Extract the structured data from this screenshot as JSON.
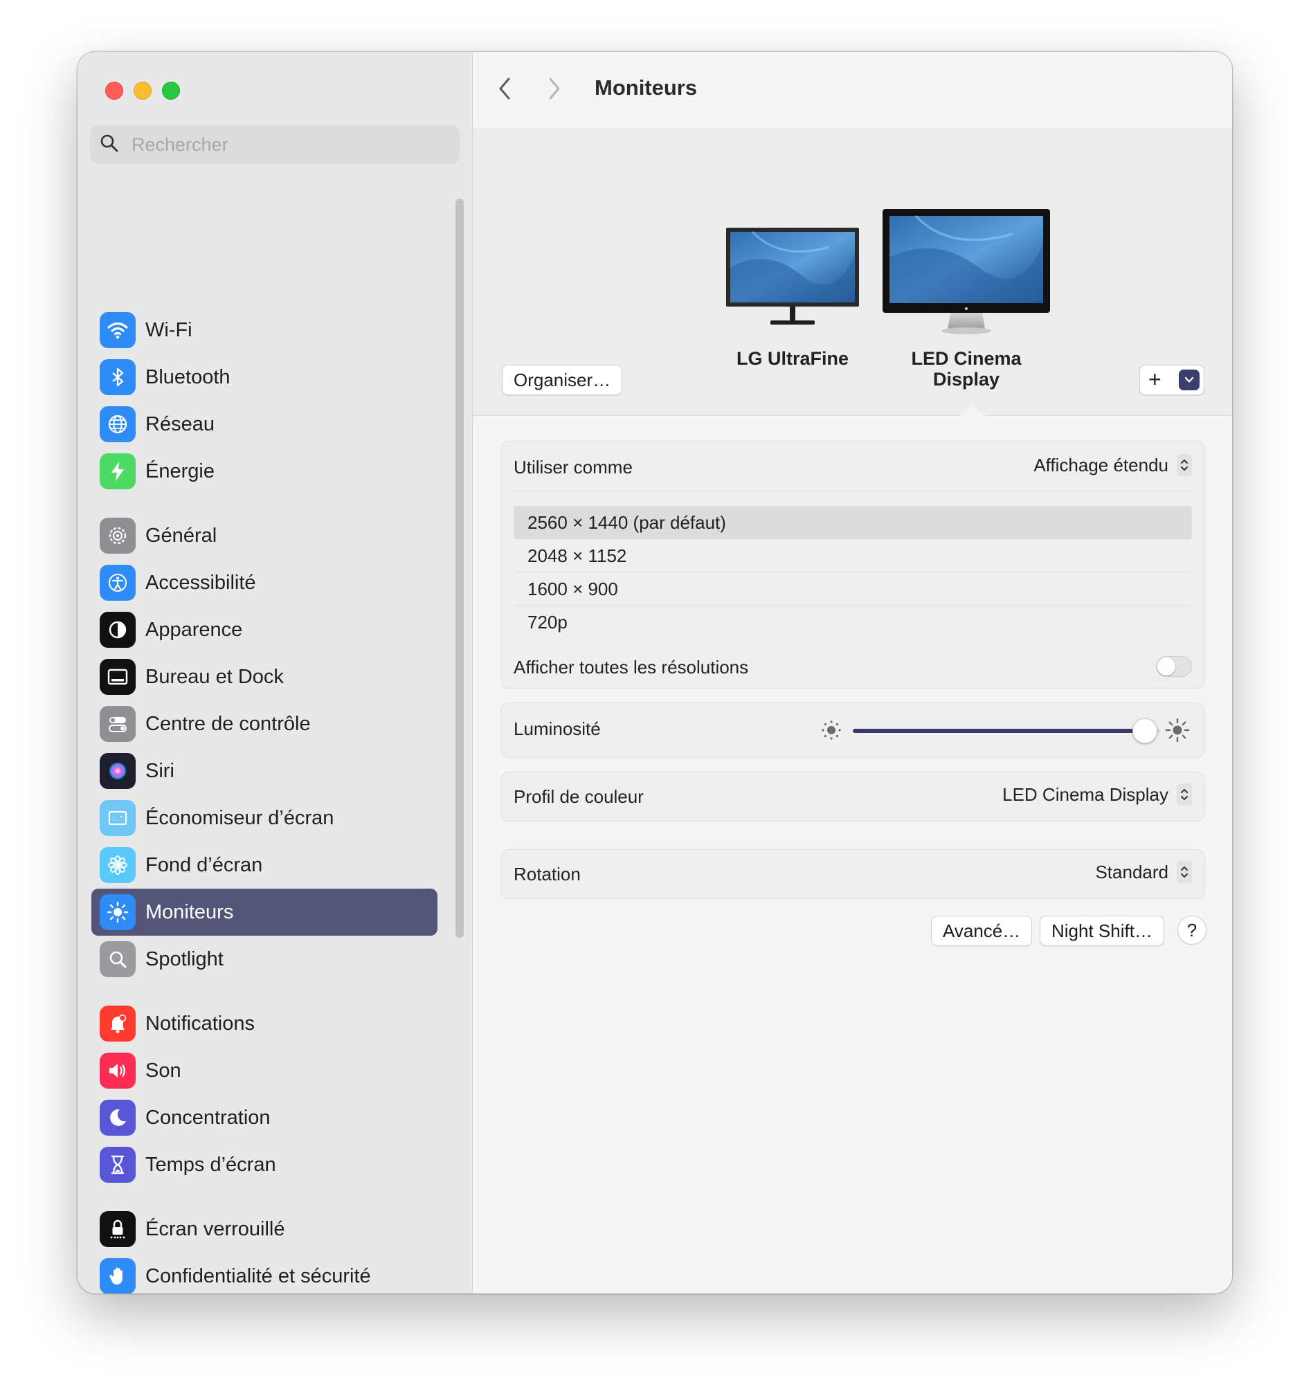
{
  "window": {
    "search_placeholder": "Rechercher"
  },
  "sidebar": {
    "items": [
      {
        "label": "Wi-Fi",
        "icon": "wifi-icon",
        "color": "#2f8cf6"
      },
      {
        "label": "Bluetooth",
        "icon": "bluetooth-icon",
        "color": "#2f8cf6"
      },
      {
        "label": "Réseau",
        "icon": "globe-icon",
        "color": "#2f8cf6"
      },
      {
        "label": "Énergie",
        "icon": "bolt-icon",
        "color": "#4cd964"
      },
      {
        "label": "Général",
        "icon": "gear-icon",
        "color": "#8e8e93"
      },
      {
        "label": "Accessibilité",
        "icon": "accessibility-icon",
        "color": "#2f8cf6"
      },
      {
        "label": "Apparence",
        "icon": "appearance-icon",
        "color": "#111111"
      },
      {
        "label": "Bureau et Dock",
        "icon": "dock-icon",
        "color": "#111111"
      },
      {
        "label": "Centre de contrôle",
        "icon": "toggles-icon",
        "color": "#8e8e93"
      },
      {
        "label": "Siri",
        "icon": "siri-icon",
        "color": "#2a2a3a"
      },
      {
        "label": "Économiseur d’écran",
        "icon": "screensaver-icon",
        "color": "#6ec7f5"
      },
      {
        "label": "Fond d’écran",
        "icon": "flower-icon",
        "color": "#5ac8fa"
      },
      {
        "label": "Moniteurs",
        "icon": "sun-icon",
        "color": "#2f8cf6",
        "active": true
      },
      {
        "label": "Spotlight",
        "icon": "magnifier-icon",
        "color": "#9a9a9f"
      },
      {
        "label": "Notifications",
        "icon": "bell-icon",
        "color": "#ff3b30"
      },
      {
        "label": "Son",
        "icon": "speaker-icon",
        "color": "#ff2d55"
      },
      {
        "label": "Concentration",
        "icon": "moon-icon",
        "color": "#5856d6"
      },
      {
        "label": "Temps d’écran",
        "icon": "hourglass-icon",
        "color": "#5856d6"
      },
      {
        "label": "Écran verrouillé",
        "icon": "lock-icon",
        "color": "#111111"
      },
      {
        "label": "Confidentialité et sécurité",
        "icon": "hand-icon",
        "color": "#2f8cf6"
      }
    ]
  },
  "main": {
    "title": "Moniteurs",
    "displays": [
      {
        "label": "LG UltraFine"
      },
      {
        "label_line1": "LED Cinema",
        "label_line2": "Display",
        "selected": true
      }
    ],
    "organiser_label": "Organiser…",
    "add_label": "+",
    "use_as": {
      "label": "Utiliser comme",
      "value": "Affichage étendu"
    },
    "resolutions": [
      {
        "label": "2560 × 1440 (par défaut)",
        "selected": true
      },
      {
        "label": "2048 × 1152"
      },
      {
        "label": "1600 × 900"
      },
      {
        "label": "720p"
      }
    ],
    "show_all": {
      "label": "Afficher toutes les résolutions",
      "on": false
    },
    "brightness": {
      "label": "Luminosité",
      "value": 0.95
    },
    "color_profile": {
      "label": "Profil de couleur",
      "value": "LED Cinema Display"
    },
    "rotation": {
      "label": "Rotation",
      "value": "Standard"
    },
    "advanced_label": "Avancé…",
    "night_shift_label": "Night Shift…",
    "help_label": "?",
    "accent": "#3a3c66"
  }
}
